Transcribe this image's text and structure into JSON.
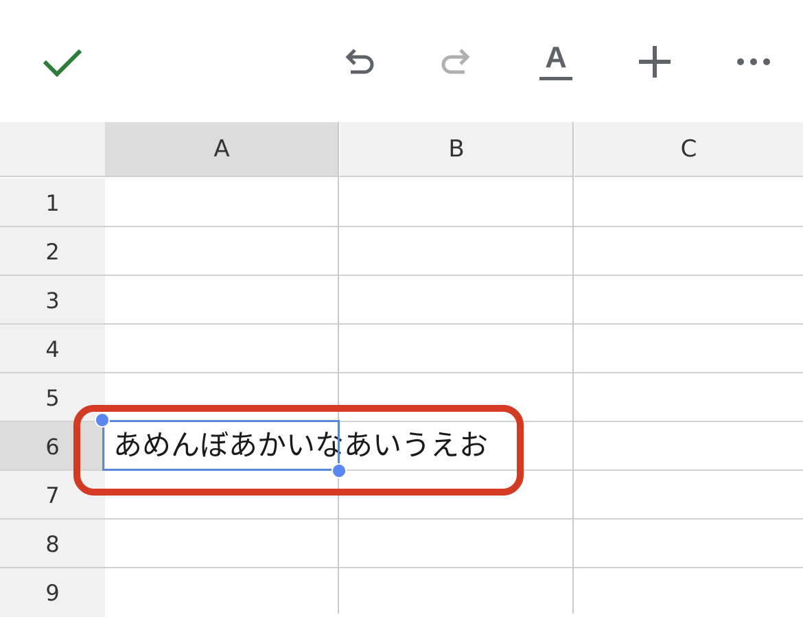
{
  "toolbar": {
    "done_icon": "checkmark-icon",
    "undo_icon": "undo-icon",
    "redo_icon": "redo-icon",
    "format_label": "A",
    "insert_icon": "plus-icon",
    "more_icon": "more-horizontal-icon"
  },
  "colors": {
    "check": "#2e7d3a",
    "icon": "#5f6368",
    "icon_disabled": "#b0b0b0",
    "selection": "#5a87d8",
    "highlight": "#d33a22"
  },
  "columns": [
    "A",
    "B",
    "C"
  ],
  "rows": [
    "1",
    "2",
    "3",
    "4",
    "5",
    "6",
    "7",
    "8",
    "9"
  ],
  "active_cell": {
    "ref": "A6",
    "value": "あめんぼあかいなあいうえお"
  }
}
